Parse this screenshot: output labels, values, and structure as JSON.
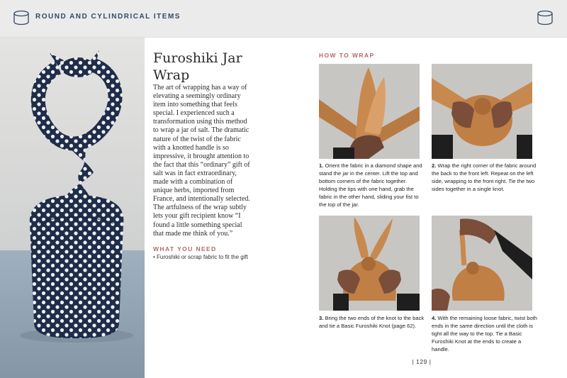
{
  "header": {
    "title": "ROUND AND CYLINDRICAL ITEMS",
    "left_icon": "cylinder-icon",
    "right_icon": "cylinder-icon"
  },
  "colors": {
    "header_bg": "#ecebeb",
    "header_text": "#2f4a66",
    "accent": "#b46a6a",
    "fabric_navy": "#1f2d4a",
    "fabric_tan": "#c8894e",
    "counter_gray": "#c8c6c3"
  },
  "article": {
    "title": "Furoshiki Jar Wrap",
    "body": "The art of wrapping has a way of elevating a seemingly ordinary item into something that feels special. I experienced such a transformation using this method to wrap a jar of salt. The dramatic nature of the twist of the fabric with a knotted handle is so impressive, it brought attention to the fact that this “ordinary” gift of salt was in fact extraordinary, made with a combination of unique herbs, imported from France, and intentionally selected. The artfulness of the wrap subtly lets your gift recipient know “I found a little something special that made me think of you.”",
    "what_you_need_heading": "WHAT YOU NEED",
    "what_you_need_item": "• Furoshiki or scrap fabric to fit the gift"
  },
  "how_to_wrap": {
    "heading": "HOW TO WRAP",
    "steps": [
      {
        "num": "1.",
        "text": " Orient the fabric in a diamond shape and stand the jar in the center. Lift the top and bottom corners of the fabric together. Holding the tips with one hand, grab the fabric in the other hand, sliding your fist to the top of the jar."
      },
      {
        "num": "2.",
        "text": " Wrap the right corner of the fabric around the back to the front left. Repeat on the left side, wrapping to the front right. Tie the two sides together in a single knot."
      },
      {
        "num": "3.",
        "text": " Bring the two ends of the knot to the back and tie a Basic Furoshiki Knot (page 62)."
      },
      {
        "num": "4.",
        "text": " With the remaining loose fabric, twist both ends in the same direction until the cloth is tight all the way to the top. Tie a Basic Furoshiki Knot at the ends to create a handle."
      }
    ]
  },
  "page_number": "| 129 |"
}
